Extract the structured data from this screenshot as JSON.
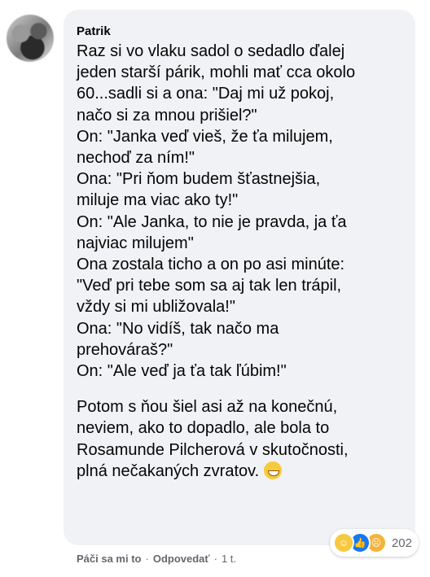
{
  "comment": {
    "author": "Patrik",
    "paragraph1": "Raz si vo vlaku sadol o sedadlo ďalej\njeden starší párik, mohli mať cca okolo\n60...sadli si a ona: \"Daj mi už pokoj,\nnačo si za mnou prišiel?\"\nOn: \"Janka veď vieš, že ťa milujem,\nnechoď za ním!\"\nOna: \"Pri ňom budem šťastnejšia,\nmiluje ma viac ako ty!\"\nOn: \"Ale Janka, to nie je pravda, ja ťa\nnajviac milujem\"\nOna zostala ticho a on po asi minúte:\n\"Veď pri tebe som sa aj tak len trápil,\nvždy si mi ubližovala!\"\nOna: \"No vidíš, tak načo ma\nprehováraš?\"\nOn: \"Ale veď ja ťa tak ľúbim!\"",
    "paragraph2": "Potom s ňou šiel asi až na konečnú,\nneviem, ako to dopadlo, ale bola to\nRosamunde Pilcherová v skutočnosti,\nplná nečakaných zvratov.",
    "emoji": "grinning-face"
  },
  "reactions": {
    "icons": [
      "haha",
      "like",
      "sad"
    ],
    "count": "202"
  },
  "actions": {
    "like_label": "Páči sa mi to",
    "separator": "·",
    "reply_label": "Odpovedať",
    "time": "1 t."
  },
  "colors": {
    "bubble": "#f0f2f5",
    "meta_text": "#65676b",
    "like_blue": "#1877f2"
  }
}
